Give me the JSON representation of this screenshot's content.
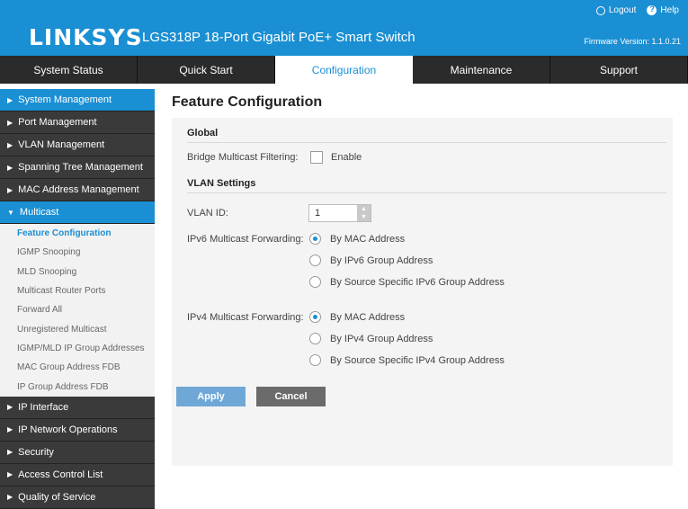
{
  "header": {
    "logo": "LINKSYS",
    "product": "LGS318P 18-Port Gigabit PoE+ Smart Switch",
    "logout": "Logout",
    "help": "Help",
    "firmware": "Firmware Version: 1.1.0.21"
  },
  "nav": [
    "System Status",
    "Quick Start",
    "Configuration",
    "Maintenance",
    "Support"
  ],
  "sidebar": {
    "groups_top": [
      "System Management",
      "Port Management",
      "VLAN Management",
      "Spanning Tree Management",
      "MAC Address Management"
    ],
    "multicast": "Multicast",
    "multicast_items": [
      "Feature Configuration",
      "IGMP Snooping",
      "MLD Snooping",
      "Multicast Router Ports",
      "Forward All",
      "Unregistered Multicast",
      "IGMP/MLD IP Group Addresses",
      "MAC Group Address FDB",
      "IP Group Address FDB"
    ],
    "groups_bottom": [
      "IP Interface",
      "IP Network Operations",
      "Security",
      "Access Control List",
      "Quality of Service"
    ]
  },
  "main": {
    "title": "Feature Configuration",
    "global": "Global",
    "bridge_label": "Bridge Multicast Filtering:",
    "enable": "Enable",
    "vlan_settings": "VLAN Settings",
    "vlan_id_label": "VLAN ID:",
    "vlan_id_value": "1",
    "ipv6_label": "IPv6 Multicast Forwarding:",
    "ipv6_options": [
      "By MAC Address",
      "By IPv6 Group Address",
      "By Source Specific IPv6 Group Address"
    ],
    "ipv4_label": "IPv4 Multicast Forwarding:",
    "ipv4_options": [
      "By MAC Address",
      "By IPv4 Group Address",
      "By Source Specific IPv4 Group Address"
    ],
    "apply": "Apply",
    "cancel": "Cancel"
  },
  "colors": {
    "brand": "#1a8fd3",
    "nav_bg": "#2b2b2b",
    "sidebar_bg": "#3a3a3a"
  }
}
